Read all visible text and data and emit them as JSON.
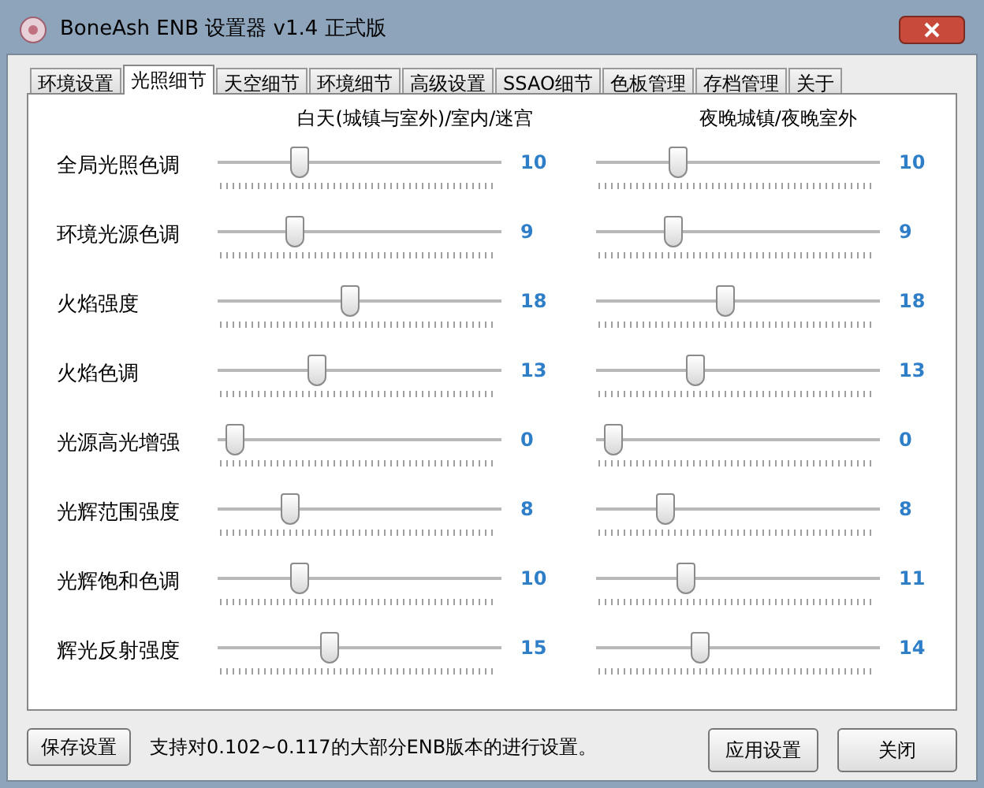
{
  "window": {
    "title": "BoneAsh ENB 设置器 v1.4 正式版"
  },
  "tabs": [
    {
      "label": "环境设置",
      "selected": false
    },
    {
      "label": "光照细节",
      "selected": true
    },
    {
      "label": "天空细节",
      "selected": false
    },
    {
      "label": "环境细节",
      "selected": false
    },
    {
      "label": "高级设置",
      "selected": false
    },
    {
      "label": "SSAO细节",
      "selected": false
    },
    {
      "label": "色板管理",
      "selected": false
    },
    {
      "label": "存档管理",
      "selected": false
    },
    {
      "label": "关于",
      "selected": false
    }
  ],
  "column_headers": [
    "白天(城镇与室外)/室内/迷宫",
    "夜晚城镇/夜晚室外"
  ],
  "rows": [
    {
      "label": "全局光照色调",
      "day": {
        "level": 0.26,
        "reading": "10"
      },
      "night": {
        "level": 0.26,
        "reading": "10"
      }
    },
    {
      "label": "环境光源色调",
      "day": {
        "level": 0.24,
        "reading": "9"
      },
      "night": {
        "level": 0.24,
        "reading": "9"
      }
    },
    {
      "label": "火焰强度",
      "day": {
        "level": 0.46,
        "reading": "18"
      },
      "night": {
        "level": 0.45,
        "reading": "18"
      }
    },
    {
      "label": "火焰色调",
      "day": {
        "level": 0.33,
        "reading": "13"
      },
      "night": {
        "level": 0.33,
        "reading": "13"
      }
    },
    {
      "label": "光源高光增强",
      "day": {
        "level": 0.0,
        "reading": "0"
      },
      "night": {
        "level": 0.0,
        "reading": "0"
      }
    },
    {
      "label": "光辉范围强度",
      "day": {
        "level": 0.22,
        "reading": "8"
      },
      "night": {
        "level": 0.21,
        "reading": "8"
      }
    },
    {
      "label": "光辉饱和色调",
      "day": {
        "level": 0.26,
        "reading": "10"
      },
      "night": {
        "level": 0.29,
        "reading": "11"
      }
    },
    {
      "label": "辉光反射强度",
      "day": {
        "level": 0.38,
        "reading": "15"
      },
      "night": {
        "level": 0.35,
        "reading": "14"
      }
    }
  ],
  "footer": {
    "save_button": "保存设置",
    "note": "支持对0.102~0.117的大部分ENB版本的进行设置。",
    "apply_button": "应用设置",
    "close_button": "关闭"
  }
}
